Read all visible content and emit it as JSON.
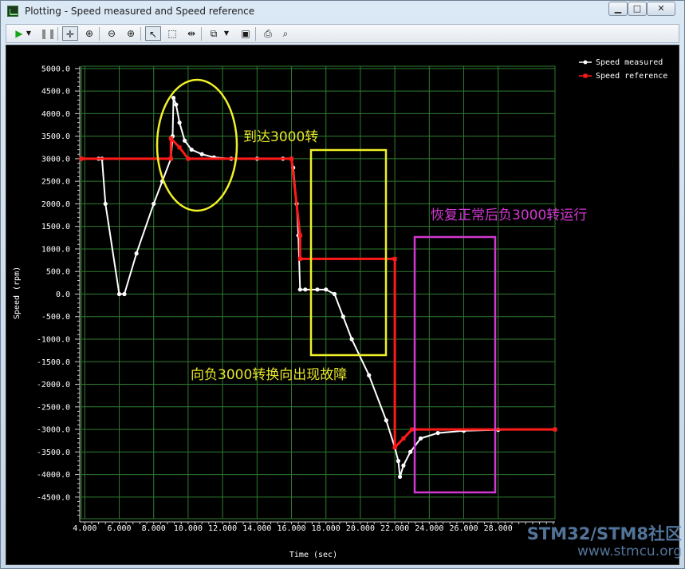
{
  "window": {
    "title": "Plotting - Speed measured and Speed reference",
    "minimize": "▁",
    "maximize": "□",
    "close": "✕"
  },
  "toolbar": {
    "icons": [
      "play-icon",
      "dropdown-icon",
      "pause-icon",
      "pan-icon",
      "zoom-axis-icon",
      "zoom-out-icon",
      "zoom-in-icon",
      "select-pointer-icon",
      "select-rect-icon",
      "fit-icon",
      "copy-icon",
      "dropdown-icon",
      "save-icon",
      "print-icon",
      "print-preview-icon"
    ]
  },
  "chart_data": {
    "type": "line",
    "xlabel": "Time (sec)",
    "ylabel": "Speed (rpm)",
    "xlim": [
      3.8,
      31.3
    ],
    "ylim": [
      -4980,
      5050
    ],
    "x_ticks": [
      "4.000",
      "6.000",
      "8.000",
      "10.000",
      "12.000",
      "14.000",
      "16.000",
      "18.000",
      "20.000",
      "22.000",
      "24.000",
      "26.000",
      "28.000"
    ],
    "x_tick_values": [
      4,
      6,
      8,
      10,
      12,
      14,
      16,
      18,
      20,
      22,
      24,
      26,
      28
    ],
    "y_ticks": [
      "5000.0",
      "4500.0",
      "4000.0",
      "3500.0",
      "3000.0",
      "2500.0",
      "2000.0",
      "1500.0",
      "1000.0",
      "500.0",
      "0.0",
      "-500.0",
      "-1000.0",
      "-1500.0",
      "-2000.0",
      "-2500.0",
      "-3000.0",
      "-3500.0",
      "-4000.0",
      "-4500.0"
    ],
    "y_tick_values": [
      5000,
      4500,
      4000,
      3500,
      3000,
      2500,
      2000,
      1500,
      1000,
      500,
      0,
      -500,
      -1000,
      -1500,
      -2000,
      -2500,
      -3000,
      -3500,
      -4000,
      -4500
    ],
    "grid": true,
    "legend_position": "top-right",
    "series": [
      {
        "name": "Speed measured",
        "color": "#ffffff",
        "x": [
          3.8,
          4.8,
          5.0,
          5.2,
          6.0,
          6.3,
          7.0,
          8.0,
          8.5,
          9.0,
          9.1,
          9.15,
          9.3,
          9.5,
          9.8,
          10.2,
          10.8,
          11.5,
          12.5,
          14.0,
          15.5,
          16.0,
          16.1,
          16.3,
          16.4,
          16.5,
          16.8,
          17.5,
          18.0,
          18.5,
          19.0,
          19.5,
          20.5,
          21.5,
          22.0,
          22.2,
          22.3,
          22.5,
          22.9,
          23.5,
          24.5,
          26.0,
          28.0,
          31.3
        ],
        "y": [
          3000,
          3000,
          3000,
          2000,
          0,
          0,
          900,
          2000,
          2500,
          3000,
          3500,
          4350,
          4200,
          3800,
          3400,
          3200,
          3100,
          3030,
          3000,
          3000,
          3000,
          3000,
          2800,
          2000,
          1300,
          100,
          100,
          100,
          100,
          0,
          -500,
          -1000,
          -1800,
          -2800,
          -3400,
          -3700,
          -4050,
          -3800,
          -3500,
          -3200,
          -3080,
          -3030,
          -3010,
          -3000
        ]
      },
      {
        "name": "Speed reference",
        "color": "#ff1a1a",
        "x": [
          3.8,
          9.0,
          9.0,
          9.5,
          10.0,
          16.0,
          16.5,
          16.5,
          22.0,
          22.0,
          22.5,
          23.0,
          31.3
        ],
        "y": [
          3000,
          3000,
          3450,
          3250,
          3000,
          3000,
          1300,
          780,
          780,
          -3400,
          -3200,
          -3000,
          -3000
        ]
      }
    ]
  },
  "annotations": {
    "arrive": "到达3000转",
    "recover": "恢复正常后负3000转运行",
    "fault": "向负3000转换向出现故障"
  },
  "watermark": {
    "line1": "STM32/STM8社区",
    "line2": "www.stmcu.org"
  }
}
